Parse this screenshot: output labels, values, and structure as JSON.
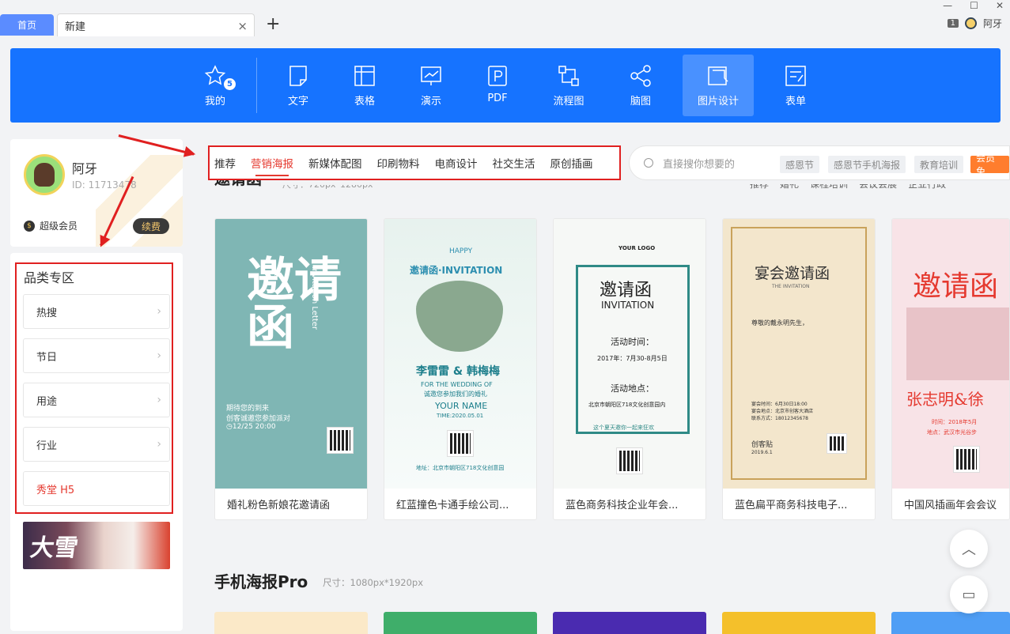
{
  "tabs": {
    "home": "首页",
    "current": "新建",
    "close": "×",
    "add": "+"
  },
  "window": {
    "badge": "1",
    "user": "阿牙",
    "minimize": "—",
    "maximize": "☐",
    "close": "✕"
  },
  "nav": {
    "items": [
      {
        "label": "我的",
        "badge": "5",
        "icon": "star-icon"
      },
      {
        "label": "文字",
        "icon": "document-icon"
      },
      {
        "label": "表格",
        "icon": "table-icon"
      },
      {
        "label": "演示",
        "icon": "presentation-icon"
      },
      {
        "label": "PDF",
        "icon": "pdf-icon"
      },
      {
        "label": "流程图",
        "icon": "flowchart-icon"
      },
      {
        "label": "脑图",
        "icon": "mindmap-icon"
      },
      {
        "label": "图片设计",
        "icon": "image-design-icon",
        "active": true
      },
      {
        "label": "表单",
        "icon": "form-icon"
      }
    ]
  },
  "profile": {
    "name": "阿牙",
    "id": "ID: 11713478",
    "vip": "超级会员",
    "renew": "续费"
  },
  "categories": {
    "title": "品类专区",
    "items": [
      "热搜",
      "节日",
      "用途",
      "行业",
      "秀堂 H5"
    ]
  },
  "banner": {
    "text": "大雪"
  },
  "topcats": {
    "items": [
      "推荐",
      "营销海报",
      "新媒体配图",
      "印刷物料",
      "电商设计",
      "社交生活",
      "原创插画"
    ],
    "active": "营销海报"
  },
  "search": {
    "placeholder": "直接搜你想要的",
    "chips": [
      "感恩节",
      "感恩节手机海报",
      "教育培训",
      "会员免"
    ]
  },
  "section1": {
    "title": "邀请函",
    "size": "尺寸：720px*1280px",
    "filters": [
      "推荐",
      "婚礼",
      "课程培训",
      "会议会展",
      "企业行政"
    ]
  },
  "cards": [
    {
      "caption": "婚礼粉色新娘花邀请函",
      "title": "邀请函",
      "sub": "Invitation Letter",
      "lines": [
        "期待您的到来",
        "创客诚邀您参加派对",
        "◷12/25  20:00"
      ]
    },
    {
      "caption": "红蓝撞色卡通手绘公司...",
      "header": "HAPPY",
      "title": "邀请函·INVITATION",
      "names": "李雷雷 & 韩梅梅",
      "lines": [
        "FOR THE WEDDING OF",
        "诚邀您参加我们的婚礼",
        "YOUR NAME",
        "TIME:2020.05.01"
      ],
      "addr": "地址：北京市朝阳区718文化创意园"
    },
    {
      "caption": "蓝色商务科技企业年会...",
      "logo": "YOUR LOGO",
      "title": "邀请函",
      "en": "INVITATION",
      "lines": [
        "活动时间：",
        "2017年：7月30-8月5日",
        "活动地点：",
        "北京市朝阳区718文化创意园内",
        "这个夏天邀你一起来狂欢"
      ]
    },
    {
      "caption": "蓝色扁平商务科技电子...",
      "title": "宴会邀请函",
      "en": "THE INVITATION",
      "lines": [
        "尊敬的戴永明先生，",
        "宴会时间：6月30日18:00",
        "宴会地点：北京市创客大酒店",
        "联系方式：18012345678",
        "创客贴",
        "2019.6.1"
      ]
    },
    {
      "caption": "中国风插画年会会议",
      "title": "邀请函",
      "names": "张志明&徐",
      "lines": [
        "时间：2018年5月",
        "地点：武汉市光谷步"
      ]
    }
  ],
  "section2": {
    "title": "手机海报Pro",
    "size": "尺寸：1080px*1920px"
  },
  "colors": {
    "nav": "#1673ff",
    "accent": "#e5392f",
    "highlight": "#e02020"
  }
}
